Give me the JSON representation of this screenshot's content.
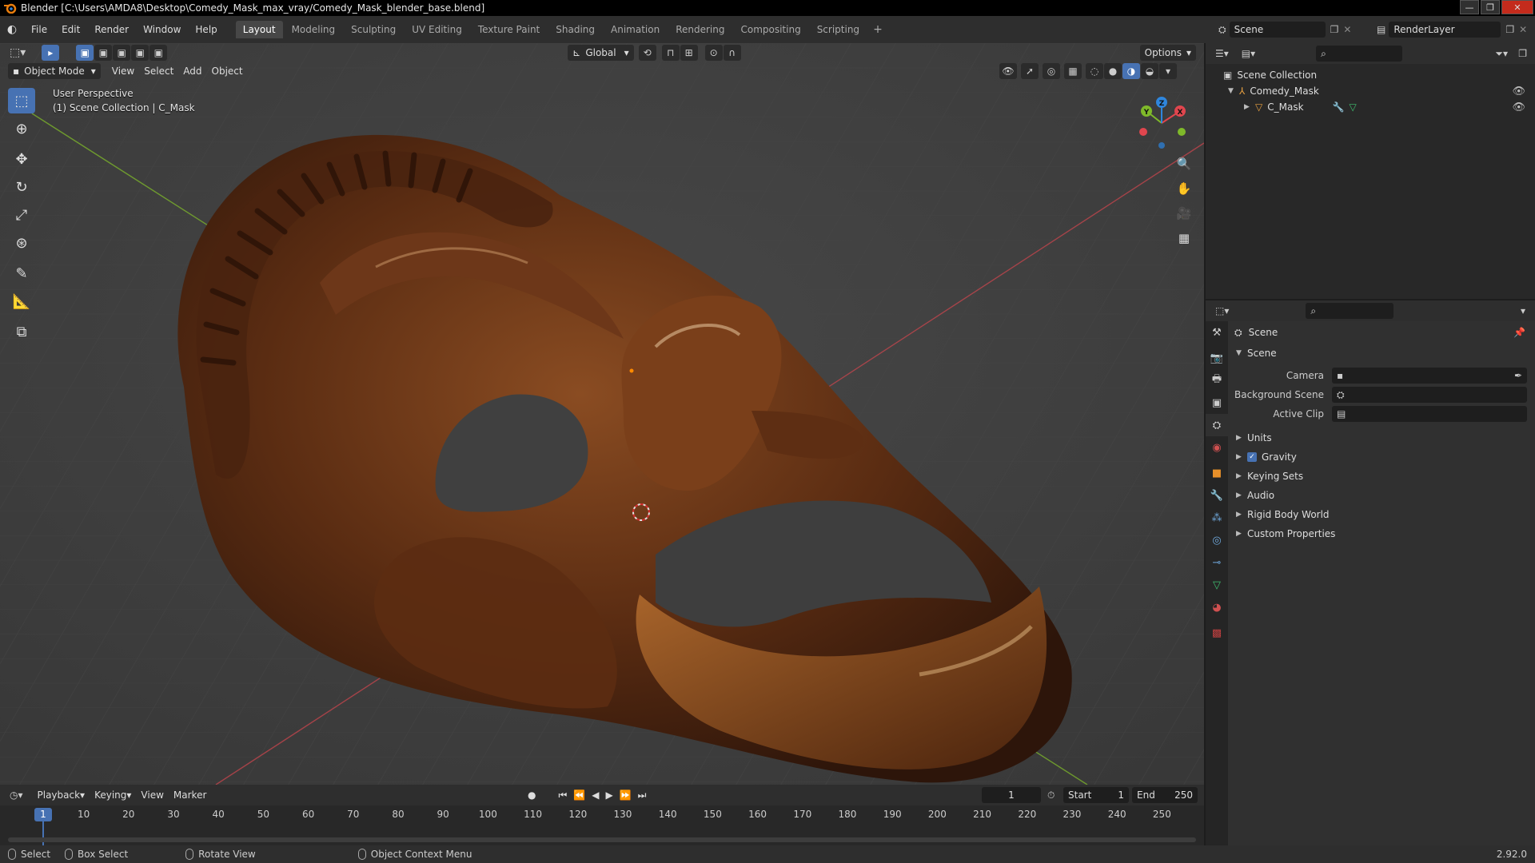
{
  "window": {
    "title": "Blender [C:\\Users\\AMDA8\\Desktop\\Comedy_Mask_max_vray/Comedy_Mask_blender_base.blend]"
  },
  "menus": [
    "File",
    "Edit",
    "Render",
    "Window",
    "Help"
  ],
  "workspaces": [
    "Layout",
    "Modeling",
    "Sculpting",
    "UV Editing",
    "Texture Paint",
    "Shading",
    "Animation",
    "Rendering",
    "Compositing",
    "Scripting"
  ],
  "active_workspace": "Layout",
  "scene_field": "Scene",
  "view_layer_field": "RenderLayer",
  "viewport": {
    "mode": "Object Mode",
    "menu": [
      "View",
      "Select",
      "Add",
      "Object"
    ],
    "transform_orientation": "Global",
    "options_label": "Options",
    "perspective_label": "User Perspective",
    "collection_label": "(1) Scene Collection | C_Mask",
    "gizmo_axes": {
      "x": "X",
      "y": "Y",
      "z": "Z"
    }
  },
  "outliner": {
    "root": "Scene Collection",
    "collection": "Comedy_Mask",
    "object": "C_Mask"
  },
  "properties": {
    "context_label": "Scene",
    "panel_title": "Scene",
    "fields": [
      {
        "label": "Camera"
      },
      {
        "label": "Background Scene"
      },
      {
        "label": "Active Clip"
      }
    ],
    "panels": [
      "Units",
      "Gravity",
      "Keying Sets",
      "Audio",
      "Rigid Body World",
      "Custom Properties"
    ],
    "gravity_checked": true
  },
  "timeline": {
    "menu": [
      "Playback",
      "Keying",
      "View",
      "Marker"
    ],
    "current_frame": "1",
    "start_label": "Start",
    "start_value": "1",
    "end_label": "End",
    "end_value": "250",
    "ruler": [
      "1",
      "10",
      "20",
      "30",
      "40",
      "50",
      "60",
      "70",
      "80",
      "90",
      "100",
      "110",
      "120",
      "130",
      "140",
      "150",
      "160",
      "170",
      "180",
      "190",
      "200",
      "210",
      "220",
      "230",
      "240",
      "250"
    ]
  },
  "statusbar": {
    "select": "Select",
    "box_select": "Box Select",
    "rotate_view": "Rotate View",
    "context_menu": "Object Context Menu",
    "version": "2.92.0"
  },
  "colors": {
    "accent": "#4772b3",
    "x_axis": "#e0464e",
    "y_axis": "#7fb92a",
    "z_axis": "#2f86dd",
    "mask_dark": "#3a1d0e",
    "mask_mid": "#7a431d",
    "mask_light": "#b3702f"
  }
}
